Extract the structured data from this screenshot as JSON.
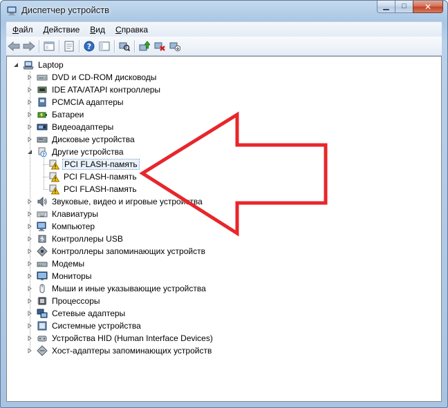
{
  "window": {
    "title": "Диспетчер устройств",
    "min_glyph": "▁",
    "max_glyph": "□",
    "close_glyph": "✕"
  },
  "menu": {
    "items": [
      {
        "label": "Файл",
        "accel": "Ф",
        "rest": "айл"
      },
      {
        "label": "Действие",
        "accel": "Д",
        "rest": "ействие"
      },
      {
        "label": "Вид",
        "accel": "В",
        "rest": "ид"
      },
      {
        "label": "Справка",
        "accel": "С",
        "rest": "правка"
      }
    ]
  },
  "toolbar": {
    "icons": [
      "back-arrow-icon",
      "forward-arrow-icon",
      "console-tree-icon",
      "properties-icon",
      "help-icon",
      "scan-hardware-icon",
      "update-driver-icon",
      "uninstall-icon",
      "disable-device-icon"
    ]
  },
  "tree": {
    "root": "Laptop",
    "items": [
      {
        "label": "DVD и CD-ROM дисководы",
        "icon": "dvd-drive-icon"
      },
      {
        "label": "IDE ATA/ATAPI контроллеры",
        "icon": "ide-controller-icon"
      },
      {
        "label": "PCMCIA адаптеры",
        "icon": "pcmcia-icon"
      },
      {
        "label": "Батареи",
        "icon": "battery-icon"
      },
      {
        "label": "Видеоадаптеры",
        "icon": "display-adapter-icon"
      },
      {
        "label": "Дисковые устройства",
        "icon": "disk-drive-icon"
      },
      {
        "label": "Другие устройства",
        "icon": "other-devices-icon",
        "expanded": true,
        "children": [
          {
            "label": "PCI FLASH-память",
            "selected": true
          },
          {
            "label": "PCI FLASH-память"
          },
          {
            "label": "PCI FLASH-память"
          }
        ]
      },
      {
        "label": "Звуковые, видео и игровые устройства",
        "icon": "sound-icon"
      },
      {
        "label": "Клавиатуры",
        "icon": "keyboard-icon"
      },
      {
        "label": "Компьютер",
        "icon": "computer-icon"
      },
      {
        "label": "Контроллеры USB",
        "icon": "usb-icon"
      },
      {
        "label": "Контроллеры запоминающих устройств",
        "icon": "storage-controller-icon"
      },
      {
        "label": "Модемы",
        "icon": "modem-icon"
      },
      {
        "label": "Мониторы",
        "icon": "monitor-icon"
      },
      {
        "label": "Мыши и иные указывающие устройства",
        "icon": "mouse-icon"
      },
      {
        "label": "Процессоры",
        "icon": "processor-icon"
      },
      {
        "label": "Сетевые адаптеры",
        "icon": "network-adapter-icon"
      },
      {
        "label": "Системные устройства",
        "icon": "system-device-icon"
      },
      {
        "label": "Устройства HID (Human Interface Devices)",
        "icon": "hid-icon"
      },
      {
        "label": "Хост-адаптеры запоминающих устройств",
        "icon": "storage-host-icon"
      }
    ]
  },
  "colors": {
    "arrow": "#e8262b",
    "selection": "#eaf2fb",
    "warning": "#f5c400"
  }
}
